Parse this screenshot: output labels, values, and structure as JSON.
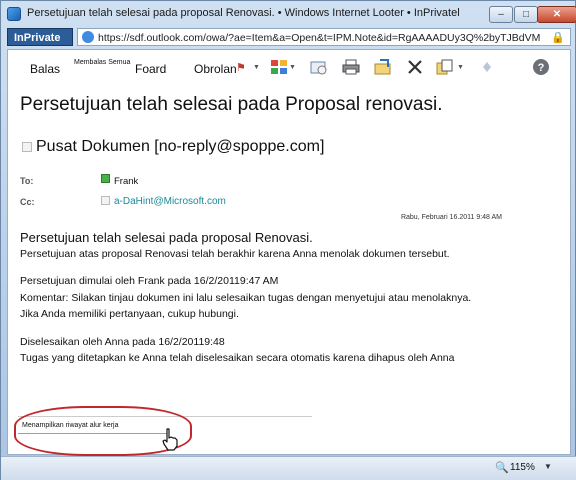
{
  "window": {
    "title": "Persetujuan telah selesai pada proposal Renovasi. • Windows Internet Looter • InPrivatel",
    "minimize_label": "–",
    "maximize_label": "□",
    "close_label": "✕"
  },
  "addressbar": {
    "inprivate_label": "InPrivate",
    "url": "https://sdf.outlook.com/owa/?ae=Item&a=Open&t=IPM.Note&id=RgAAAADUy3Q%2byTJBdVM"
  },
  "toolbar": {
    "reply": "Balas",
    "reply_all": "Membalas Semua",
    "forward": "Foard",
    "chat": "Obrolan",
    "icons": [
      "categories-icon",
      "meeting-icon",
      "print-icon",
      "move-icon",
      "delete-icon",
      "copy-icon",
      "next-icon",
      "help-icon"
    ]
  },
  "message": {
    "subject": "Persetujuan telah selesai pada   Proposal renovasi.",
    "sender": "Pusat Dokumen [no-reply@spoppe.com]",
    "to_label": "To:",
    "to_value": "Frank",
    "cc_label": "Cc:",
    "cc_value": "a-DaHint@Microsoft.com",
    "datetime": "Rabu, Februari 16.2011 9:48 AM"
  },
  "body": {
    "heading": "Persetujuan telah selesai pada proposal Renovasi.",
    "line1": "Persetujuan atas proposal Renovasi telah berakhir karena Anna menolak dokumen tersebut.",
    "started": "Persetujuan dimulai oleh Frank pada 16/2/20119:47 AM",
    "comment": "Komentar: Silakan tinjau dokumen ini lalu selesaikan tugas dengan menyetujui atau menolaknya.",
    "contact": "Jika Anda memiliki pertanyaan, cukup hubungi.",
    "completed": "Diselesaikan oleh Anna pada 16/2/20119:48",
    "tasks": "Tugas yang ditetapkan ke Anna telah diselesaikan secara otomatis karena dihapus oleh Anna",
    "workflow_link": "Menampilkan riwayat alur kerja"
  },
  "statusbar": {
    "zoom": "115%"
  },
  "colors": {
    "highlight": "#c0282c",
    "link": "#1a8a9a",
    "inprivate_bg": "#2d5d98"
  }
}
